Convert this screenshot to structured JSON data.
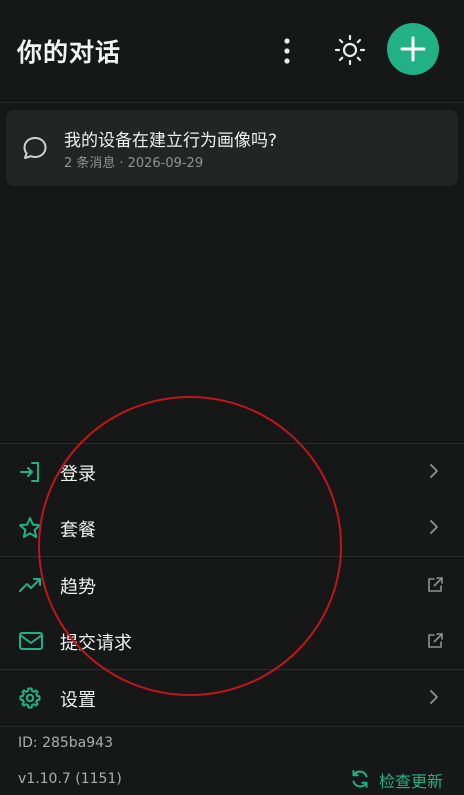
{
  "header": {
    "title": "你的对话",
    "icons": {
      "more": "more-vertical-icon",
      "theme": "sun-icon",
      "new_chat": "plus-icon"
    }
  },
  "conversation": {
    "title": "我的设备在建立行为画像吗?",
    "message_count": "2 条消息",
    "separator": "·",
    "date": "2026-09-29",
    "icon": "chat-bubble-icon"
  },
  "menu": {
    "items": [
      {
        "label": "登录",
        "icon": "login-icon",
        "right_icon": "chevron-right-icon"
      },
      {
        "label": "套餐",
        "icon": "star-icon",
        "right_icon": "chevron-right-icon"
      },
      {
        "label": "趋势",
        "icon": "trending-icon",
        "right_icon": "external-link-icon"
      },
      {
        "label": "提交请求",
        "icon": "mail-icon",
        "right_icon": "external-link-icon"
      },
      {
        "label": "设置",
        "icon": "gear-icon",
        "right_icon": "chevron-right-icon"
      }
    ]
  },
  "footer": {
    "id": "ID:  285ba943",
    "version": "v1.10.7 (1151)",
    "update_label": "检查更新",
    "update_icon": "refresh-icon"
  },
  "colors": {
    "background": "#161717",
    "card": "#222524",
    "accent": "#21b184",
    "annotation_circle": "#c0151b"
  }
}
